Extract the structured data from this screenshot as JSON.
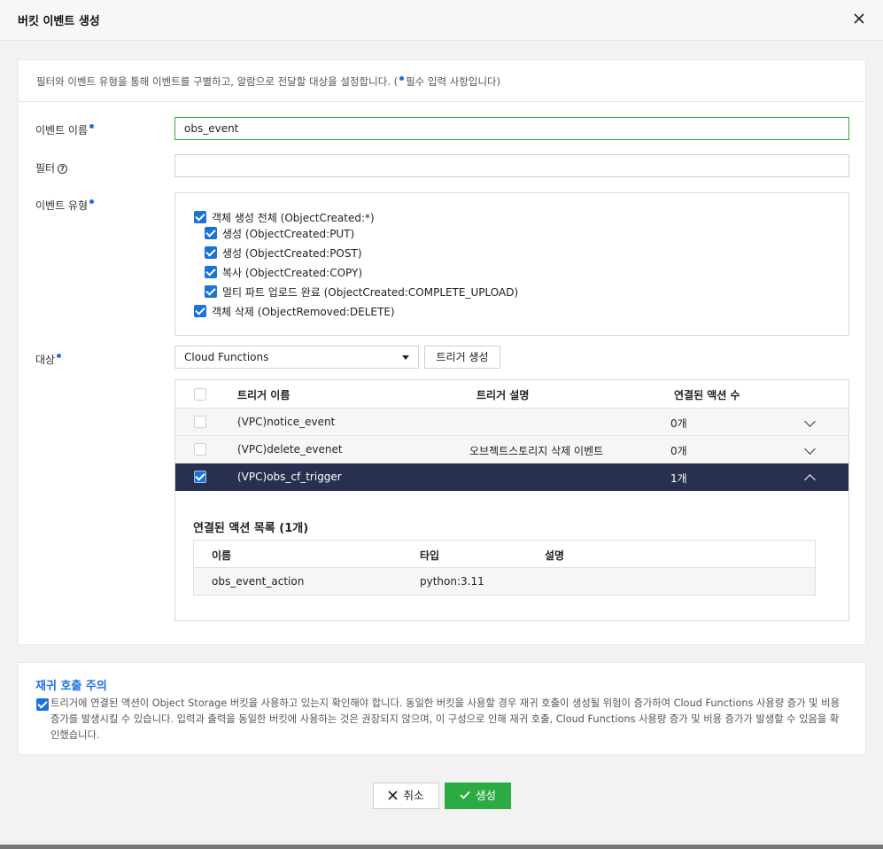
{
  "modal": {
    "title": "버킷 이벤트 생성",
    "info_prefix": "필터와 이벤트 유형을 통해 이벤트를 구별하고, 알람으로 전달할 대상을 설정합니다. (",
    "info_suffix": "필수 입력 사항입니다)"
  },
  "form": {
    "event_name_label": "이벤트 이름",
    "event_name_value": "obs_event",
    "filter_label": "필터",
    "filter_help": "?",
    "filter_value": "",
    "event_type_label": "이벤트 유형",
    "event_types": [
      {
        "label": "객체 생성 전체 (ObjectCreated:*)",
        "checked": true
      },
      {
        "label": "생성 (ObjectCreated:PUT)",
        "checked": true
      },
      {
        "label": "생성 (ObjectCreated:POST)",
        "checked": true
      },
      {
        "label": "복사 (ObjectCreated:COPY)",
        "checked": true
      },
      {
        "label": "멀티 파트 업로드 완료 (ObjectCreated:COMPLETE_UPLOAD)",
        "checked": true
      },
      {
        "label": "객체 삭제 (ObjectRemoved:DELETE)",
        "checked": true
      }
    ],
    "target_label": "대상",
    "target_value": "Cloud Functions",
    "trigger_create_label": "트리거 생성"
  },
  "trigger_table": {
    "headers": {
      "name": "트리거 이름",
      "desc": "트리거 설명",
      "count": "연결된 액션 수"
    },
    "rows": [
      {
        "name": "(VPC)notice_event",
        "desc": "",
        "count": "0개",
        "selected": false
      },
      {
        "name": "(VPC)delete_evenet",
        "desc": "오브젝트스토리지 삭제 이벤트",
        "count": "0개",
        "selected": false
      },
      {
        "name": "(VPC)obs_cf_trigger",
        "desc": "",
        "count": "1개",
        "selected": true
      }
    ],
    "linked_actions_title": "연결된 액션 목록 (1개)",
    "linked_headers": {
      "name": "이름",
      "type": "타입",
      "desc": "설명"
    },
    "linked_rows": [
      {
        "name": "obs_event_action",
        "type": "python:3.11",
        "desc": ""
      }
    ]
  },
  "warning": {
    "title": "재귀 호출 주의",
    "text": "트리거에 연결된 액션이 Object Storage 버킷을 사용하고 있는지 확인해야 합니다. 동일한 버킷을 사용할 경우 재귀 호출이 생성될 위험이 증가하여 Cloud Functions 사용량 증가 및 비용 증가를 발생시킬 수 있습니다. 입력과 출력을 동일한 버킷에 사용하는 것은 권장되지 않으며, 이 구성으로 인해 재귀 호출, Cloud Functions 사용량 증가 및 비용 증가가 발생할 수 있음을 확인했습니다.",
    "checked": true
  },
  "footer": {
    "cancel_label": "취소",
    "create_label": "생성"
  },
  "colors": {
    "accent_blue": "#1b73d6",
    "primary_green": "#2dab43",
    "selected_row": "#29304f"
  }
}
